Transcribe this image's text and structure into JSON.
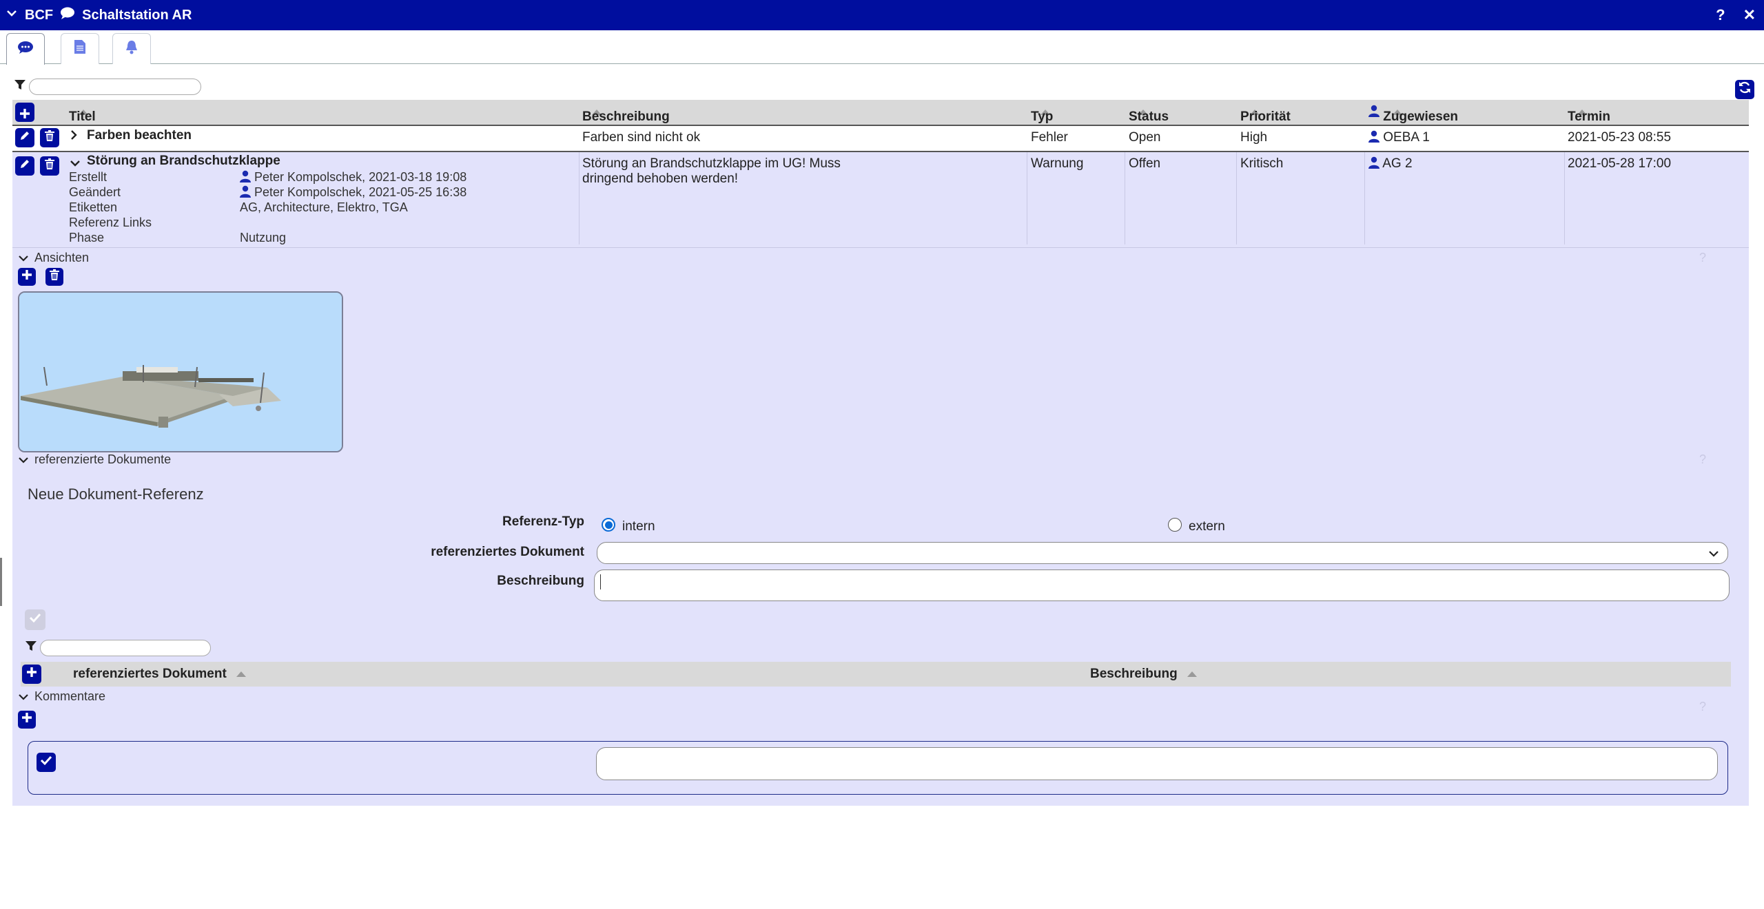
{
  "window": {
    "app": "BCF",
    "project": "Schaltstation AR",
    "help": "?",
    "close": "✕"
  },
  "filter_value": "",
  "table": {
    "headers": {
      "title": "Titel",
      "description": "Beschreibung",
      "type": "Typ",
      "status": "Status",
      "priority": "Priorität",
      "assigned": "Zugewiesen",
      "due": "Termin"
    },
    "rows": [
      {
        "title": "Farben beachten",
        "description": "Farben sind nicht ok",
        "type": "Fehler",
        "status": "Open",
        "priority": "High",
        "assigned": "OEBA 1",
        "due": "2021-05-23 08:55"
      },
      {
        "title": "Störung an Brandschutzklappe",
        "description_line1": "Störung an Brandschutzklappe im UG! Muss",
        "description_line2": "dringend behoben werden!",
        "type": "Warnung",
        "status": "Offen",
        "priority": "Kritisch",
        "assigned": "AG 2",
        "due": "2021-05-28 17:00",
        "meta": {
          "created_label": "Erstellt",
          "created_value": "Peter Kompolschek, 2021-03-18 19:08",
          "modified_label": "Geändert",
          "modified_value": "Peter Kompolschek, 2021-05-25 16:38",
          "tags_label": "Etiketten",
          "tags_value": "AG, Architecture, Elektro, TGA",
          "links_label": "Referenz Links",
          "phase_label": "Phase",
          "phase_value": "Nutzung"
        }
      }
    ]
  },
  "sections": {
    "views": "Ansichten",
    "documents": "referenzierte Dokumente",
    "comments": "Kommentare",
    "help": "?"
  },
  "doc_form": {
    "heading": "Neue Dokument-Referenz",
    "ref_type_label": "Referenz-Typ",
    "option_internal": "intern",
    "option_external": "extern",
    "selected": "intern",
    "document_label": "referenziertes Dokument",
    "description_label": "Beschreibung"
  },
  "doc_table": {
    "col_document": "referenziertes Dokument",
    "col_description": "Beschreibung"
  },
  "colors": {
    "accent": "#000e9e",
    "detail_bg": "#e2e2fb",
    "header_bg": "#d9d9d9"
  }
}
